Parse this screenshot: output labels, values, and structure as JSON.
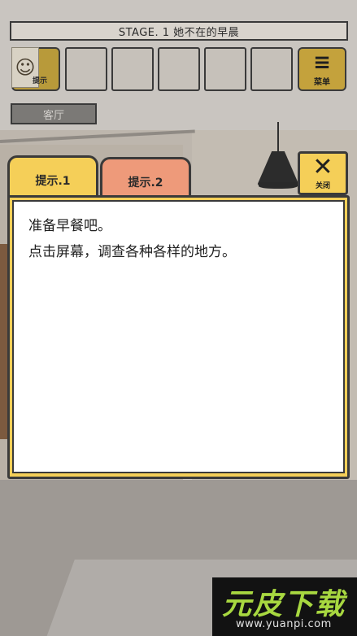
{
  "stage_title": "STAGE. 1 她不在的早晨",
  "hint_button": {
    "label": "提示",
    "thumb_icon": "character-thumbnail"
  },
  "inventory": {
    "slot_count": 5
  },
  "menu_button": {
    "label": "菜单",
    "icon": "hamburger-icon"
  },
  "room_label": "客厅",
  "hint_dialog": {
    "tabs": [
      {
        "label": "提示.1",
        "color": "#f5cf58",
        "active": true
      },
      {
        "label": "提示.2",
        "color": "#ee9a7a",
        "active": false
      }
    ],
    "close_label": "关闭",
    "close_icon": "close-icon",
    "lines": [
      "准备早餐吧。",
      "点击屏幕，调查各种各样的地方。"
    ]
  },
  "watermark": {
    "title": "元皮下载",
    "url": "www.yuanpi.com"
  },
  "colors": {
    "accent_yellow": "#f5cf58",
    "accent_salmon": "#ee9a7a",
    "outline": "#3a3a3a"
  }
}
